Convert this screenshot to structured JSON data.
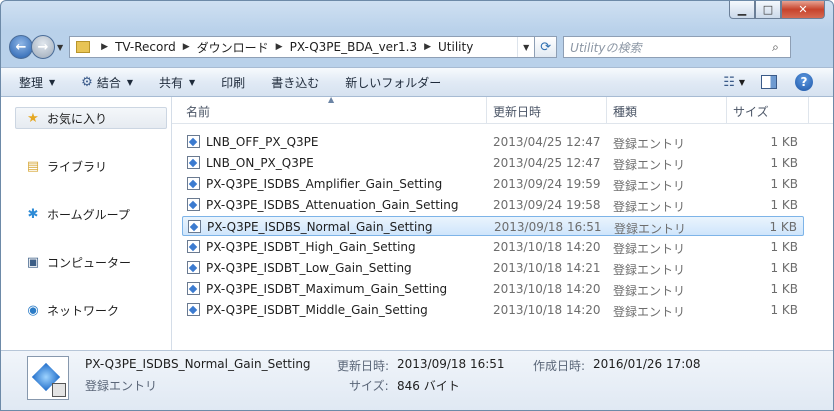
{
  "window": {
    "caption": {
      "minimize": "▁",
      "maximize": "□",
      "close": "✕"
    }
  },
  "nav": {
    "back": "←",
    "forward": "→",
    "breadcrumbs": [
      "TV-Record",
      "ダウンロード",
      "PX-Q3PE_BDA_ver1.3",
      "Utility"
    ],
    "search_placeholder": "Utilityの検索"
  },
  "commands": {
    "organize": "整理",
    "combine": "結合",
    "share": "共有",
    "print": "印刷",
    "write": "書き込む",
    "new_folder": "新しいフォルダー"
  },
  "sidebar": {
    "items": [
      {
        "label": "お気に入り",
        "icon": "star-icon"
      },
      {
        "label": "ライブラリ",
        "icon": "library-icon"
      },
      {
        "label": "ホームグループ",
        "icon": "homegroup-icon"
      },
      {
        "label": "コンピューター",
        "icon": "computer-icon"
      },
      {
        "label": "ネットワーク",
        "icon": "network-icon"
      }
    ]
  },
  "columns": {
    "name": "名前",
    "date": "更新日時",
    "type": "種類",
    "size": "サイズ"
  },
  "files": [
    {
      "name": "LNB_OFF_PX_Q3PE",
      "date": "2013/04/25 12:47",
      "type": "登録エントリ",
      "size": "1 KB"
    },
    {
      "name": "LNB_ON_PX_Q3PE",
      "date": "2013/04/25 12:47",
      "type": "登録エントリ",
      "size": "1 KB"
    },
    {
      "name": "PX-Q3PE_ISDBS_Amplifier_Gain_Setting",
      "date": "2013/09/24 19:59",
      "type": "登録エントリ",
      "size": "1 KB"
    },
    {
      "name": "PX-Q3PE_ISDBS_Attenuation_Gain_Setting",
      "date": "2013/09/24 19:58",
      "type": "登録エントリ",
      "size": "1 KB"
    },
    {
      "name": "PX-Q3PE_ISDBS_Normal_Gain_Setting",
      "date": "2013/09/18 16:51",
      "type": "登録エントリ",
      "size": "1 KB"
    },
    {
      "name": "PX-Q3PE_ISDBT_High_Gain_Setting",
      "date": "2013/10/18 14:20",
      "type": "登録エントリ",
      "size": "1 KB"
    },
    {
      "name": "PX-Q3PE_ISDBT_Low_Gain_Setting",
      "date": "2013/10/18 14:21",
      "type": "登録エントリ",
      "size": "1 KB"
    },
    {
      "name": "PX-Q3PE_ISDBT_Maximum_Gain_Setting",
      "date": "2013/10/18 14:20",
      "type": "登録エントリ",
      "size": "1 KB"
    },
    {
      "name": "PX-Q3PE_ISDBT_Middle_Gain_Setting",
      "date": "2013/10/18 14:20",
      "type": "登録エントリ",
      "size": "1 KB"
    }
  ],
  "selected_index": 4,
  "details": {
    "name": "PX-Q3PE_ISDBS_Normal_Gain_Setting",
    "type": "登録エントリ",
    "modified_label": "更新日時:",
    "modified_value": "2013/09/18 16:51",
    "created_label": "作成日時:",
    "created_value": "2016/01/26 17:08",
    "size_label": "サイズ:",
    "size_value": "846 バイト"
  }
}
